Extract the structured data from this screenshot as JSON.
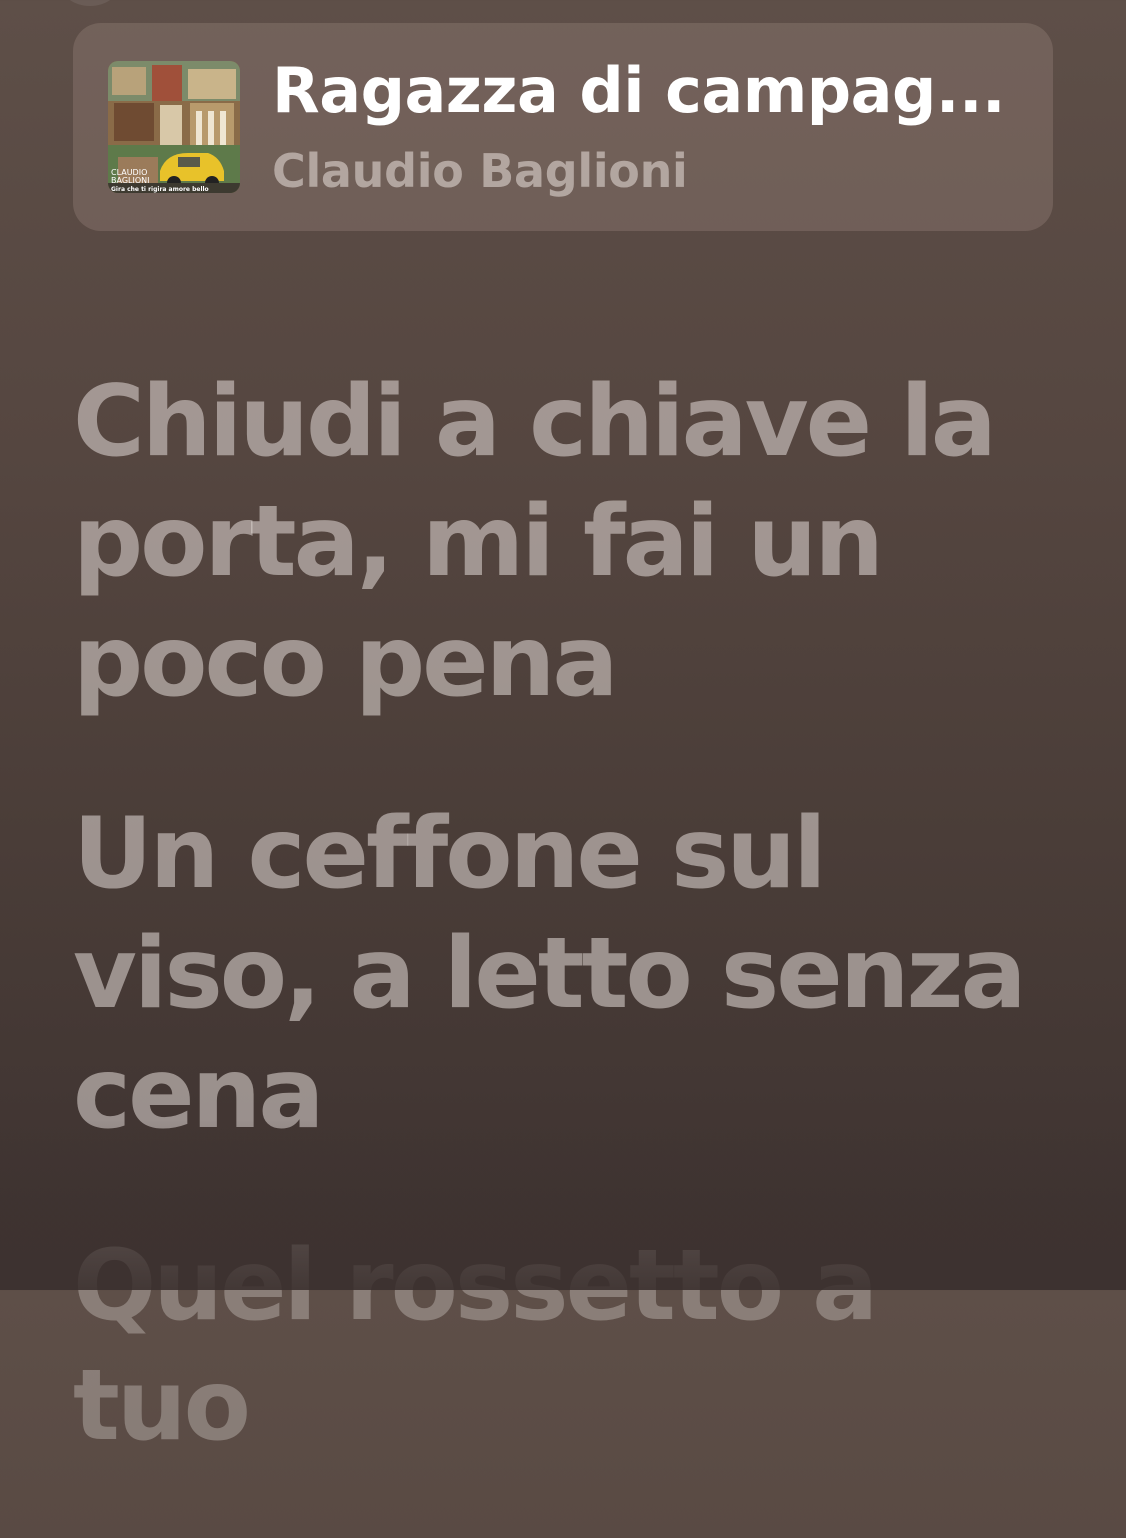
{
  "now_playing": {
    "title": "Ragazza di campag...",
    "artist": "Claudio Baglioni",
    "artwork": {
      "icon": "album-art-icon",
      "artist_text_line1": "CLAUDIO",
      "artist_text_line2": "BAGLIONI",
      "album_text": "Gira che ti rigira amore bello"
    }
  },
  "lyrics": {
    "lines": [
      "Chiudi a chiave la porta, mi fai un poco pena",
      "Un ceffone sul viso, a letto senza cena",
      "Quel rossetto a tuo"
    ]
  },
  "colors": {
    "background_top": "#5e4f48",
    "background_bottom": "#3d3230",
    "title": "#ffffff",
    "lyric_inactive": "#b8aea9"
  }
}
